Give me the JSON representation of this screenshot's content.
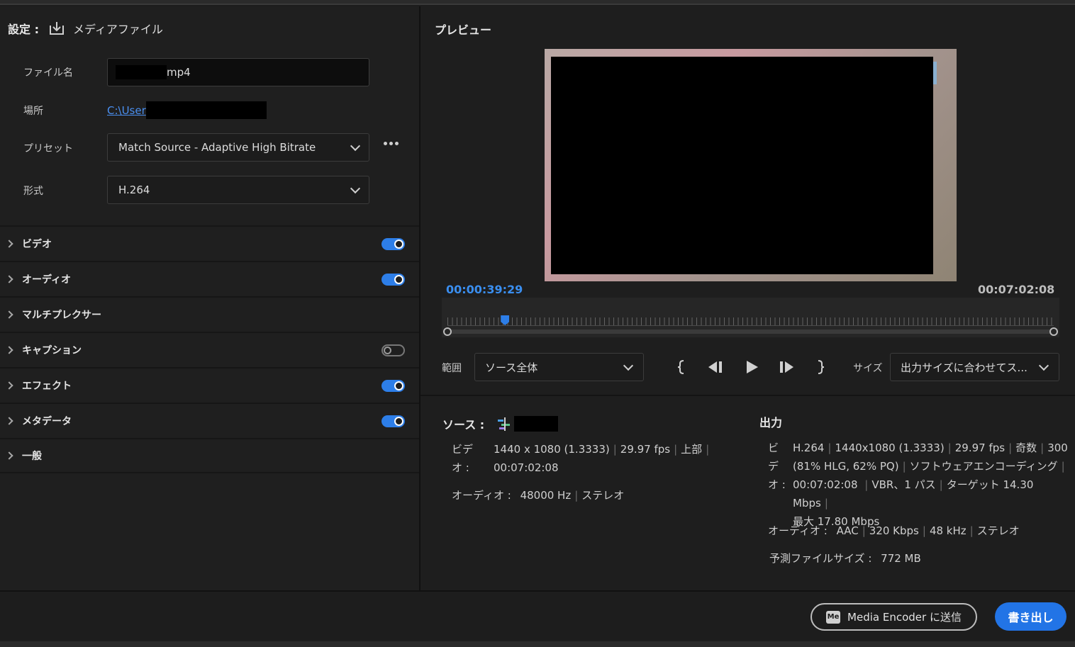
{
  "settings": {
    "label": "設定 :",
    "target": "メディアファイル",
    "filename_label": "ファイル名",
    "filename_value": "mp4",
    "location_label": "場所",
    "location_value": "C:\\User",
    "preset_label": "プリセット",
    "preset_value": "Match Source - Adaptive High Bitrate",
    "format_label": "形式",
    "format_value": "H.264"
  },
  "sections": [
    {
      "name": "ビデオ",
      "toggle": "on"
    },
    {
      "name": "オーディオ",
      "toggle": "on"
    },
    {
      "name": "マルチプレクサー",
      "toggle": "none"
    },
    {
      "name": "キャプション",
      "toggle": "off"
    },
    {
      "name": "エフェクト",
      "toggle": "on"
    },
    {
      "name": "メタデータ",
      "toggle": "on"
    },
    {
      "name": "一般",
      "toggle": "none"
    }
  ],
  "preview": {
    "title": "プレビュー",
    "current_tc": "00:00:39:29",
    "end_tc": "00:07:02:08",
    "playhead_fraction": 0.095,
    "range_label": "範囲",
    "range_value": "ソース全体",
    "size_label": "サイズ",
    "size_value": "出力サイズに合わせてス..."
  },
  "source": {
    "title": "ソース :",
    "video_k1": "ビデ",
    "video_k2": "オ :",
    "video_line1": [
      "1440 x 1080 (1.3333)",
      "29.97 fps",
      "上部",
      ""
    ],
    "video_line2": "00:07:02:08",
    "audio_k": "オーディオ :",
    "audio_line": [
      "48000 Hz",
      "ステレオ"
    ]
  },
  "output": {
    "title": "出力",
    "video_k1": "ビ",
    "video_k2": "デ",
    "video_k3": "オ :",
    "video_line1": [
      "H.264",
      "1440x1080 (1.3333)",
      "29.97 fps",
      "奇数",
      "300"
    ],
    "video_line2": [
      "(81% HLG, 62% PQ)",
      "ソフトウェアエンコーディング",
      ""
    ],
    "video_line3": [
      "00:07:02:08 ",
      "VBR、1 パス",
      "ターゲット 14.30 Mbps",
      ""
    ],
    "video_line4": "最大 17.80 Mbps",
    "audio_k": "オーディオ :",
    "audio_line": [
      "AAC",
      "320 Kbps",
      "48 kHz",
      "ステレオ"
    ],
    "size_k": "予測ファイルサイズ :",
    "size_v": "772 MB"
  },
  "buttons": {
    "media_encoder": "Media Encoder に送信",
    "media_encoder_icon": "Me",
    "export": "書き出し"
  },
  "colors": {
    "accent": "#2d7ee8",
    "timecode": "#3a8eef",
    "link": "#4a8ff0"
  }
}
